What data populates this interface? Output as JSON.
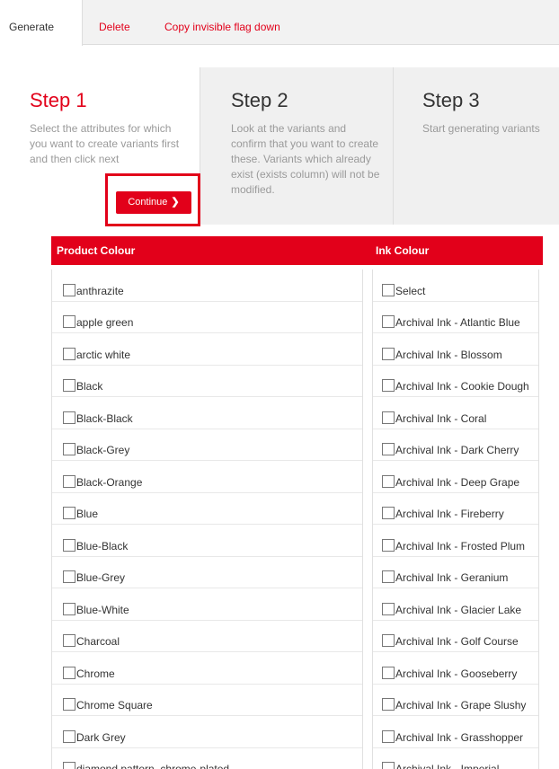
{
  "tabs": {
    "generate": "Generate",
    "delete": "Delete",
    "copy": "Copy invisible flag down"
  },
  "steps": [
    {
      "title": "Step 1",
      "desc": "Select the attributes for which you want to create variants first and then click next"
    },
    {
      "title": "Step 2",
      "desc": "Look at the variants and confirm that you want to create these. Variants which already exist (exists column) will not be modified."
    },
    {
      "title": "Step 3",
      "desc": "Start generating variants"
    }
  ],
  "continue_label": "Continue",
  "colors": {
    "accent": "#e2001a"
  },
  "table": {
    "product_header": "Product Colour",
    "ink_header": "Ink Colour",
    "product_colours": [
      "anthrazite",
      "apple green",
      "arctic white",
      "Black",
      "Black-Black",
      "Black-Grey",
      "Black-Orange",
      "Blue",
      "Blue-Black",
      "Blue-Grey",
      "Blue-White",
      "Charcoal",
      "Chrome",
      "Chrome Square",
      "Dark Grey",
      "diamond pattern, chrome-plated"
    ],
    "ink_colours": [
      "Select",
      "Archival Ink - Atlantic Blue",
      "Archival Ink - Blossom",
      "Archival Ink - Cookie Dough",
      "Archival Ink - Coral",
      "Archival Ink - Dark Cherry",
      "Archival Ink - Deep Grape",
      "Archival Ink - Fireberry",
      "Archival Ink - Frosted Plum",
      "Archival Ink - Geranium",
      "Archival Ink - Glacier Lake",
      "Archival Ink - Golf Course",
      "Archival Ink - Gooseberry",
      "Archival Ink - Grape Slushy",
      "Archival Ink - Grasshopper",
      "Archival Ink - Imperial"
    ]
  }
}
